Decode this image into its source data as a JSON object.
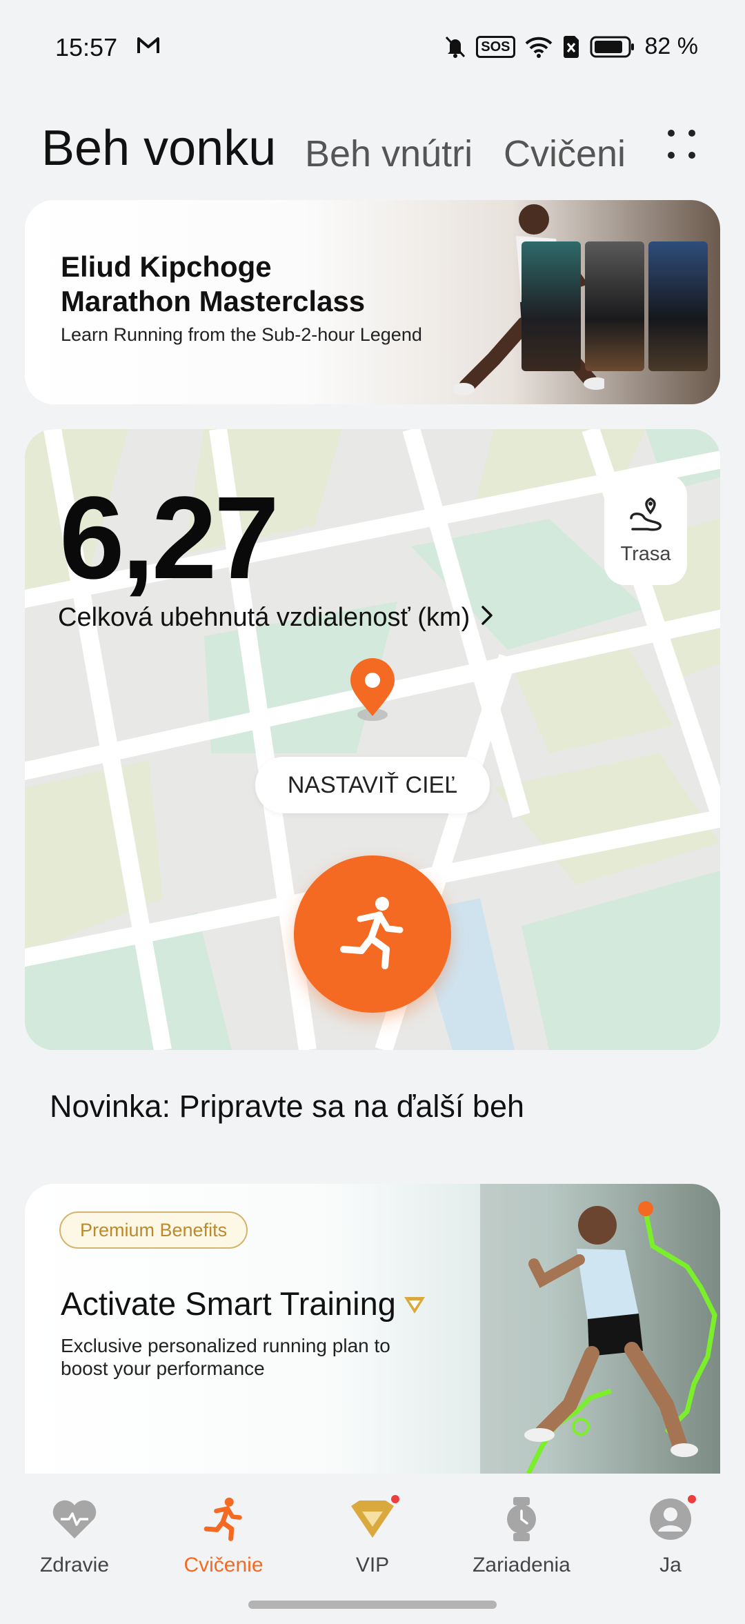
{
  "status_bar": {
    "time": "15:57",
    "battery": "82 %",
    "sos": "SOS"
  },
  "tabs": {
    "active": "Beh vonku",
    "second": "Beh vnútri",
    "third": "Cvičeni"
  },
  "banner_top": {
    "title_line1": "Eliud Kipchoge",
    "title_line2": "Marathon Masterclass",
    "subtitle": "Learn Running from the Sub-2-hour Legend"
  },
  "map_card": {
    "distance_value": "6,27",
    "distance_label": "Celková ubehnutá vzdialenosť (km)",
    "route_label": "Trasa",
    "goal_button": "NASTAVIŤ CIEĽ"
  },
  "section": {
    "title": "Novinka: Pripravte sa na ďalší beh"
  },
  "banner_bottom": {
    "badge": "Premium Benefits",
    "title": "Activate Smart Training",
    "subtitle": "Exclusive personalized running plan to boost your performance"
  },
  "bottom_nav": [
    {
      "label": "Zdravie",
      "icon": "heart-icon"
    },
    {
      "label": "Cvičenie",
      "icon": "runner-icon"
    },
    {
      "label": "VIP",
      "icon": "diamond-icon"
    },
    {
      "label": "Zariadenia",
      "icon": "watch-icon"
    },
    {
      "label": "Ja",
      "icon": "avatar-icon"
    }
  ],
  "colors": {
    "accent": "#f46a22",
    "notification": "#ef3d3d",
    "gold": "#d6b36a"
  }
}
